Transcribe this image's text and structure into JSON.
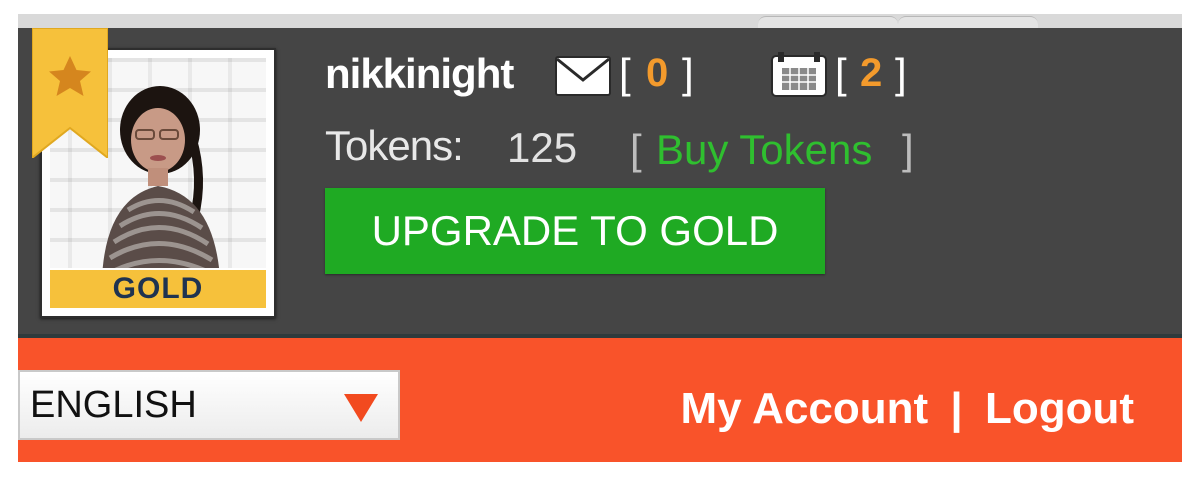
{
  "user": {
    "username": "nikkinight",
    "membership_badge": "GOLD",
    "messages_count": "0",
    "calendar_count": "2",
    "tokens_label": "Tokens:",
    "tokens_value": "125",
    "buy_tokens_label": "Buy Tokens",
    "upgrade_label": "UPGRADE TO GOLD"
  },
  "brackets": {
    "open": "[",
    "close": "]"
  },
  "nav": {
    "language_selected": "ENGLISH",
    "my_account_label": "My Account",
    "separator": "|",
    "logout_label": "Logout"
  },
  "icons": {
    "ribbon": "star-ribbon-icon",
    "mail": "mail-icon",
    "calendar": "calendar-icon",
    "dropdown": "triangle-down-icon"
  },
  "colors": {
    "header_bg": "#454545",
    "nav_bg": "#f9532a",
    "accent_gold": "#f6c13b",
    "count_orange": "#f39a2c",
    "buy_green": "#2fbf2f",
    "upgrade_green": "#1faa23"
  }
}
